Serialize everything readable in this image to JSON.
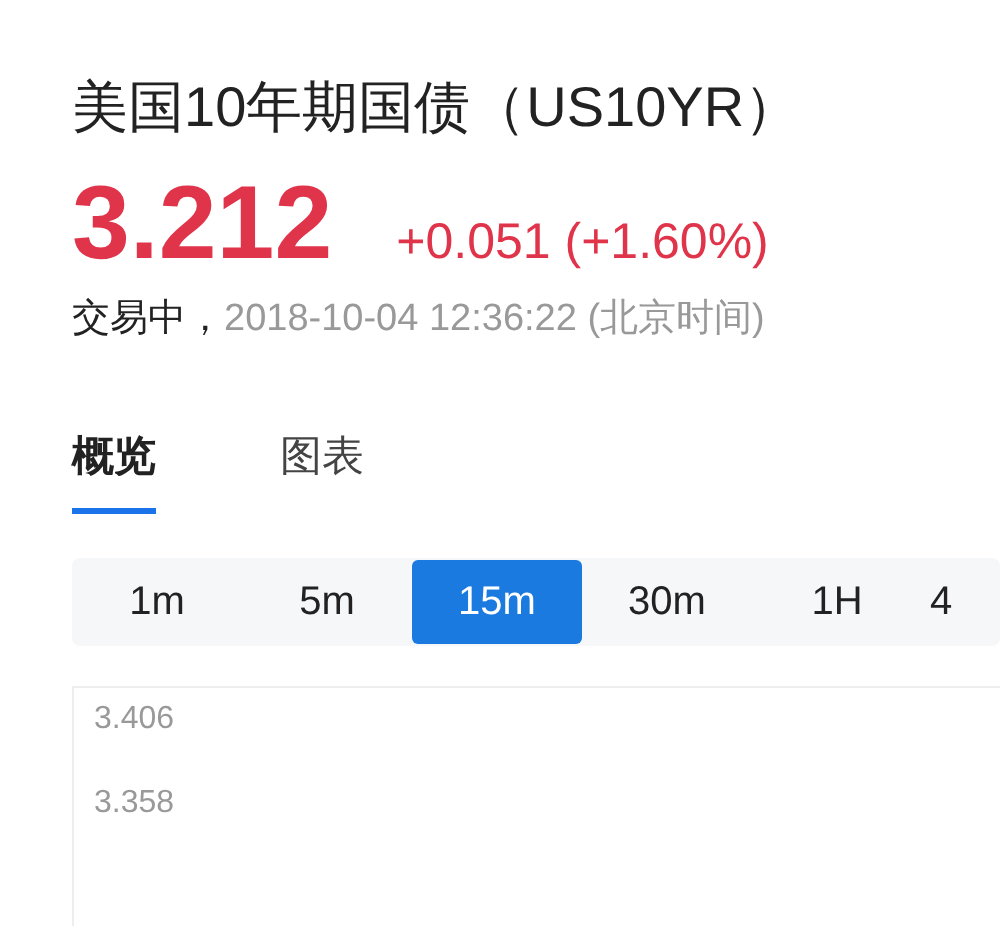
{
  "title": "美国10年期国债（US10YR）",
  "price": "3.212",
  "change": "+0.051 (+1.60%)",
  "status": {
    "state": "交易中，",
    "time": "2018-10-04 12:36:22 (北京时间)"
  },
  "tabs": [
    {
      "label": "概览",
      "selected": true
    },
    {
      "label": "图表",
      "selected": false
    }
  ],
  "intervals": [
    {
      "label": "1m",
      "selected": false
    },
    {
      "label": "5m",
      "selected": false
    },
    {
      "label": "15m",
      "selected": true
    },
    {
      "label": "30m",
      "selected": false
    },
    {
      "label": "1H",
      "selected": false
    },
    {
      "label": "4",
      "selected": false
    }
  ],
  "chart": {
    "y_labels": [
      "3.406",
      "3.358"
    ]
  }
}
